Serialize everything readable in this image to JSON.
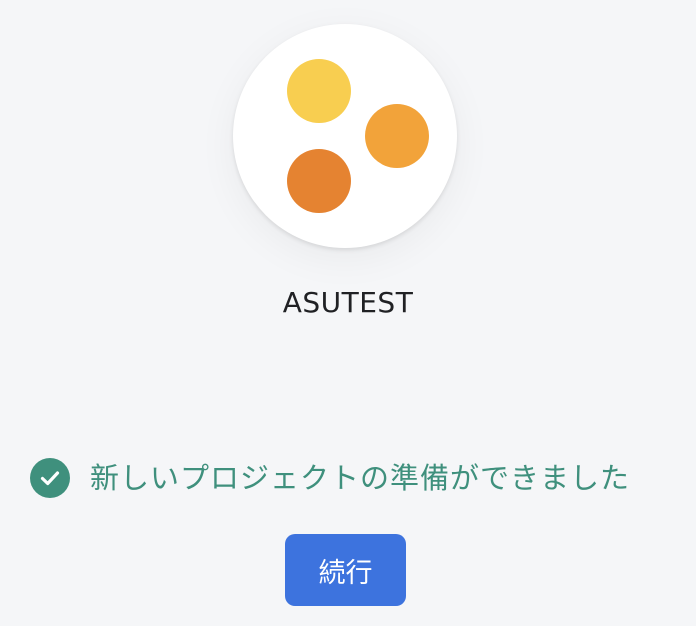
{
  "project": {
    "name": "ASUTEST",
    "logo": {
      "icon": "three-dots-logo-icon",
      "colors": [
        "#f8ce50",
        "#f2a33a",
        "#e58331"
      ]
    }
  },
  "status": {
    "icon": "check-circle-icon",
    "text": "新しいプロジェクトの準備ができました",
    "color": "#3f907d"
  },
  "actions": {
    "continue_label": "続行",
    "continue_color": "#3d73de"
  }
}
